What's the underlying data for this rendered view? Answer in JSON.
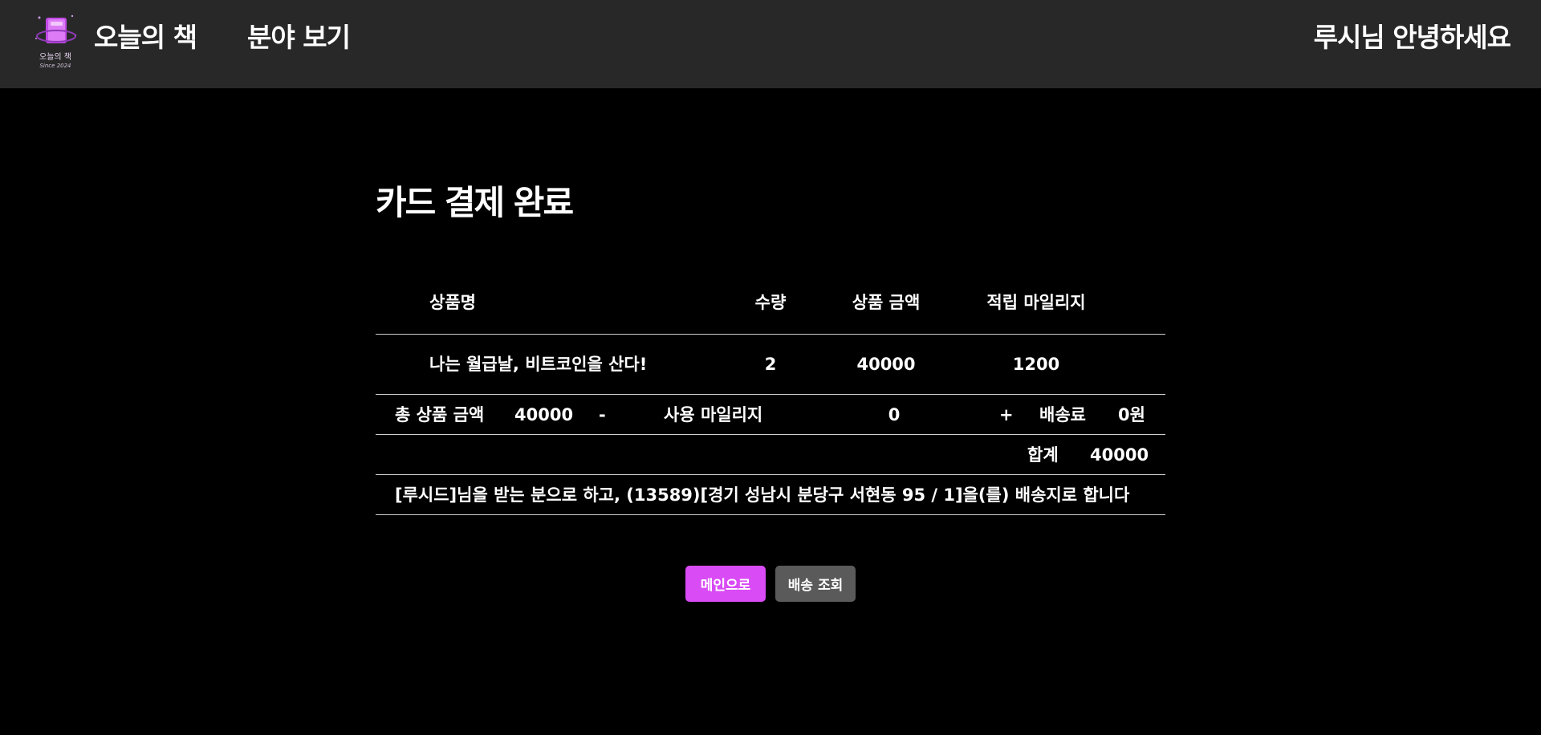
{
  "header": {
    "logo_text": "오늘의 책",
    "logo_sub": "Since 2024",
    "brand": "오늘의 책",
    "nav_category": "분야 보기",
    "greeting": "루시님 안녕하세요"
  },
  "page": {
    "title": "카드 결제 완료"
  },
  "table": {
    "headers": {
      "product": "상품명",
      "quantity": "수량",
      "price": "상품 금액",
      "mileage": "적립 마일리지"
    },
    "items": [
      {
        "product": "나는 월급날, 비트코인을 산다!",
        "quantity": "2",
        "price": "40000",
        "mileage": "1200"
      }
    ]
  },
  "summary": {
    "total_label": "총 상품 금액",
    "total_value": "40000",
    "minus": "-",
    "used_mileage_label": "사용 마일리지",
    "used_mileage_value": "0",
    "plus": "+",
    "shipping_label": "배송료",
    "shipping_value": "0원",
    "sum_label": "합계",
    "sum_value": "40000"
  },
  "address": {
    "text": "[루시드]님을 받는 분으로 하고, (13589)[경기 성남시 분당구 서현동 95 / 1]을(를) 배송지로 합니다"
  },
  "buttons": {
    "main": "메인으로",
    "track": "배송 조회"
  },
  "colors": {
    "header_bg": "#282828",
    "page_bg": "#000000",
    "accent": "#d94bf5",
    "secondary_button": "#5a5a5a",
    "divider": "#cfcfcf"
  }
}
